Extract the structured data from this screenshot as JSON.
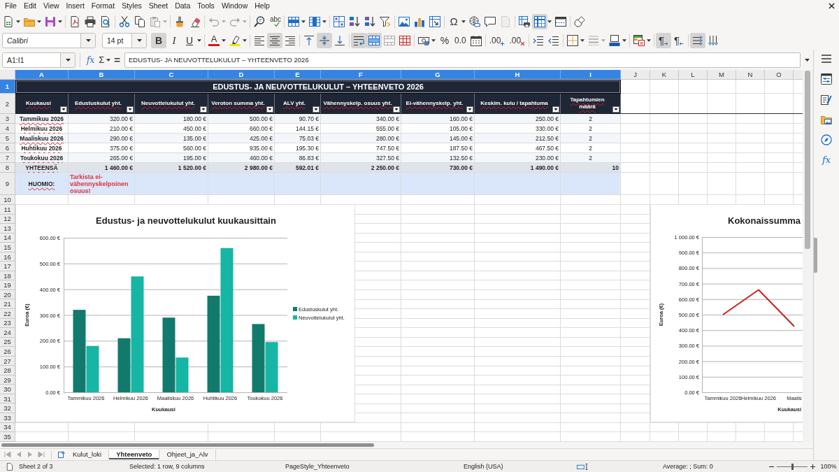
{
  "menu_bar": {
    "items": [
      "File",
      "Edit",
      "View",
      "Insert",
      "Format",
      "Styles",
      "Sheet",
      "Data",
      "Tools",
      "Window",
      "Help"
    ]
  },
  "standard_toolbar": {
    "groups": [
      [
        {
          "kind": "new",
          "on": false,
          "disabled": false,
          "menu": true
        },
        {
          "kind": "open",
          "on": false,
          "disabled": false,
          "menu": true
        },
        {
          "kind": "save",
          "on": false,
          "disabled": false,
          "menu": true
        }
      ],
      [
        {
          "kind": "pdf",
          "on": false,
          "disabled": false,
          "menu": false
        },
        {
          "kind": "print",
          "on": false,
          "disabled": false,
          "menu": false
        },
        {
          "kind": "preview",
          "on": false,
          "disabled": false,
          "menu": false
        }
      ],
      [
        {
          "kind": "cut",
          "on": false,
          "disabled": false,
          "menu": false
        },
        {
          "kind": "copy",
          "on": false,
          "disabled": false,
          "menu": false
        },
        {
          "kind": "paste",
          "on": false,
          "disabled": true,
          "menu": true
        }
      ],
      [
        {
          "kind": "clone",
          "on": false,
          "disabled": false,
          "menu": false
        },
        {
          "kind": "clear",
          "on": false,
          "disabled": false,
          "menu": false
        }
      ],
      [
        {
          "kind": "undo",
          "on": false,
          "disabled": true,
          "menu": true
        },
        {
          "kind": "redo",
          "on": false,
          "disabled": true,
          "menu": true
        }
      ],
      [
        {
          "kind": "find",
          "on": false,
          "disabled": false,
          "menu": false
        },
        {
          "kind": "spelling",
          "glyph": "abc",
          "on": false,
          "disabled": false,
          "menu": false
        }
      ],
      [
        {
          "kind": "rows",
          "on": false,
          "disabled": false,
          "menu": true
        },
        {
          "kind": "columns",
          "on": false,
          "disabled": false,
          "menu": true
        }
      ],
      [
        {
          "kind": "sort",
          "on": false,
          "disabled": false,
          "menu": false
        },
        {
          "kind": "ascending",
          "on": false,
          "disabled": false,
          "menu": false
        },
        {
          "kind": "descending",
          "on": false,
          "disabled": false,
          "menu": false
        },
        {
          "kind": "filter",
          "on": false,
          "disabled": false,
          "menu": false
        }
      ],
      [
        {
          "kind": "image",
          "on": false,
          "disabled": false,
          "menu": false
        },
        {
          "kind": "chart",
          "on": false,
          "disabled": false,
          "menu": false
        },
        {
          "kind": "pivot",
          "on": false,
          "disabled": false,
          "menu": false
        }
      ],
      [
        {
          "kind": "special",
          "glyph": "Ω",
          "on": false,
          "disabled": false,
          "menu": true
        },
        {
          "kind": "hyperlink",
          "on": false,
          "disabled": false,
          "menu": false
        },
        {
          "kind": "comment",
          "on": false,
          "disabled": false,
          "menu": false
        },
        {
          "kind": "headerfooter",
          "on": false,
          "disabled": true,
          "menu": false
        }
      ],
      [
        {
          "kind": "printarea",
          "on": false,
          "disabled": false,
          "menu": false
        },
        {
          "kind": "freeze",
          "on": true,
          "disabled": false,
          "menu": true
        },
        {
          "kind": "split",
          "on": false,
          "disabled": false,
          "menu": false
        }
      ],
      [
        {
          "kind": "shapes",
          "on": false,
          "disabled": false,
          "menu": false
        }
      ]
    ]
  },
  "formatting_toolbar": {
    "font_name": "Calibri",
    "font_size": "14 pt",
    "groups": [
      [
        {
          "kind": "bold",
          "glyph": "B",
          "on": true,
          "disabled": false,
          "menu": false
        },
        {
          "kind": "italic",
          "glyph": "I",
          "on": false,
          "disabled": false,
          "menu": false
        },
        {
          "kind": "underline",
          "glyph": "U",
          "on": false,
          "disabled": false,
          "menu": true
        }
      ],
      [
        {
          "kind": "fontcolor",
          "glyph": "A",
          "on": false,
          "disabled": false,
          "menu": true
        },
        {
          "kind": "highlight",
          "on": false,
          "disabled": false,
          "menu": true
        }
      ],
      [
        {
          "kind": "left",
          "on": false,
          "disabled": false,
          "menu": false
        },
        {
          "kind": "center",
          "on": true,
          "disabled": false,
          "menu": false
        },
        {
          "kind": "right",
          "on": false,
          "disabled": false,
          "menu": false
        }
      ],
      [
        {
          "kind": "top",
          "on": false,
          "disabled": false,
          "menu": false
        },
        {
          "kind": "middle",
          "on": true,
          "disabled": false,
          "menu": false
        },
        {
          "kind": "bottom",
          "on": false,
          "disabled": false,
          "menu": false
        }
      ],
      [
        {
          "kind": "wrap",
          "on": true,
          "disabled": false,
          "menu": false
        },
        {
          "kind": "mergecenter",
          "on": true,
          "disabled": false,
          "menu": false
        },
        {
          "kind": "merge",
          "on": false,
          "disabled": true,
          "menu": false
        },
        {
          "kind": "unmerge",
          "on": false,
          "disabled": false,
          "menu": false
        }
      ],
      [
        {
          "kind": "currency",
          "on": false,
          "disabled": false,
          "menu": true
        },
        {
          "kind": "percent",
          "glyph": "%",
          "on": false,
          "disabled": false,
          "menu": false
        },
        {
          "kind": "number",
          "glyph": "0.0",
          "on": false,
          "disabled": false,
          "menu": false
        },
        {
          "kind": "date",
          "on": false,
          "disabled": false,
          "menu": false
        }
      ],
      [
        {
          "kind": "adddecimal",
          "glyph": ".00",
          "on": false,
          "disabled": false,
          "menu": false
        },
        {
          "kind": "deletedecimal",
          "glyph": ".00",
          "on": false,
          "disabled": false,
          "menu": false
        }
      ],
      [
        {
          "kind": "indent",
          "on": false,
          "disabled": false,
          "menu": false
        },
        {
          "kind": "outdent",
          "on": false,
          "disabled": false,
          "menu": false
        }
      ],
      [
        {
          "kind": "borders",
          "on": false,
          "disabled": false,
          "menu": true
        },
        {
          "kind": "borderstyle",
          "on": false,
          "disabled": true,
          "menu": true
        },
        {
          "kind": "bordercolor",
          "on": false,
          "disabled": false,
          "menu": true
        }
      ],
      [
        {
          "kind": "conditional",
          "on": false,
          "disabled": false,
          "menu": true
        }
      ],
      [
        {
          "kind": "ltr",
          "glyph": "¶",
          "on": true,
          "disabled": false,
          "menu": false
        },
        {
          "kind": "rtl",
          "glyph": "¶",
          "on": false,
          "disabled": false,
          "menu": false
        }
      ],
      [
        {
          "kind": "horizontal",
          "on": true,
          "disabled": false,
          "menu": false
        },
        {
          "kind": "vertical",
          "on": false,
          "disabled": false,
          "menu": false
        }
      ]
    ]
  },
  "formula_bar": {
    "name_box": "A1:I1",
    "buttons": [
      {
        "glyph": "fx",
        "menu": false
      },
      {
        "glyph": "Σ",
        "menu": true
      },
      {
        "glyph": "=",
        "menu": false
      }
    ],
    "content": "EDUSTUS- JA NEUVOTTELUKULUT – YHTEENVETO 2026"
  },
  "sheet": {
    "column_headers": [
      {
        "label": "A",
        "selected": true
      },
      {
        "label": "B",
        "selected": true
      },
      {
        "label": "C",
        "selected": true
      },
      {
        "label": "D",
        "selected": true
      },
      {
        "label": "E",
        "selected": true
      },
      {
        "label": "F",
        "selected": true
      },
      {
        "label": "G",
        "selected": true
      },
      {
        "label": "H",
        "selected": true
      },
      {
        "label": "I",
        "selected": true
      },
      {
        "label": "J",
        "selected": false
      },
      {
        "label": "K",
        "selected": false
      },
      {
        "label": "L",
        "selected": false
      },
      {
        "label": "M",
        "selected": false
      },
      {
        "label": "N",
        "selected": false
      },
      {
        "label": "O",
        "selected": false
      }
    ],
    "row_headers": [
      {
        "label": "1",
        "selected": true
      },
      {
        "label": "2",
        "selected": false
      },
      {
        "label": "3",
        "selected": false
      },
      {
        "label": "4",
        "selected": false
      },
      {
        "label": "5",
        "selected": false
      },
      {
        "label": "6",
        "selected": false
      },
      {
        "label": "7",
        "selected": false
      },
      {
        "label": "8",
        "selected": false
      },
      {
        "label": "9",
        "selected": false
      },
      {
        "label": "10",
        "selected": false
      },
      {
        "label": "11",
        "selected": false
      },
      {
        "label": "12",
        "selected": false
      },
      {
        "label": "13",
        "selected": false
      },
      {
        "label": "14",
        "selected": false
      },
      {
        "label": "15",
        "selected": false
      },
      {
        "label": "16",
        "selected": false
      },
      {
        "label": "17",
        "selected": false
      },
      {
        "label": "18",
        "selected": false
      },
      {
        "label": "19",
        "selected": false
      },
      {
        "label": "20",
        "selected": false
      },
      {
        "label": "21",
        "selected": false
      },
      {
        "label": "22",
        "selected": false
      },
      {
        "label": "23",
        "selected": false
      },
      {
        "label": "24",
        "selected": false
      },
      {
        "label": "25",
        "selected": false
      },
      {
        "label": "26",
        "selected": false
      },
      {
        "label": "27",
        "selected": false
      },
      {
        "label": "28",
        "selected": false
      },
      {
        "label": "29",
        "selected": false
      },
      {
        "label": "30",
        "selected": false
      },
      {
        "label": "31",
        "selected": false
      },
      {
        "label": "32",
        "selected": false
      },
      {
        "label": "33",
        "selected": false
      },
      {
        "label": "34",
        "selected": false
      },
      {
        "label": "35",
        "selected": false
      }
    ],
    "spell_marks": true,
    "title": "EDUSTUS- JA NEUVOTTELUKULUT – YHTEENVETO 2026",
    "headers": [
      {
        "label": "Kuukausi",
        "filter": true
      },
      {
        "label": "Edustuskulut yht.",
        "filter": true
      },
      {
        "label": "Neuvottelukulut yht.",
        "filter": true
      },
      {
        "label": "Veroton summa yht.",
        "filter": true
      },
      {
        "label": "ALV yht.",
        "filter": true
      },
      {
        "label": "Vähennyskelp. osuus yht.",
        "filter": true
      },
      {
        "label": "Ei-vähennyskelp. yht.",
        "filter": true
      },
      {
        "label": "Keskim. kulu / tapahtuma",
        "filter": true
      },
      {
        "label": "Tapahtumien määrä",
        "filter": true
      }
    ],
    "rows": [
      [
        "Tammikuu 2026",
        "320.00 €",
        "180.00 €",
        "500.00 €",
        "90.70 €",
        "340.00 €",
        "160.00 €",
        "250.00 €",
        "2"
      ],
      [
        "Helmikuu 2026",
        "210.00 €",
        "450.00 €",
        "660.00 €",
        "144.15 €",
        "555.00 €",
        "105.00 €",
        "330.00 €",
        "2"
      ],
      [
        "Maaliskuu 2026",
        "290.00 €",
        "135.00 €",
        "425.00 €",
        "75.03 €",
        "280.00 €",
        "145.00 €",
        "212.50 €",
        "2"
      ],
      [
        "Huhtikuu 2026",
        "375.00 €",
        "560.00 €",
        "935.00 €",
        "195.30 €",
        "747.50 €",
        "187.50 €",
        "467.50 €",
        "2"
      ],
      [
        "Toukokuu 2026",
        "265.00 €",
        "195.00 €",
        "460.00 €",
        "86.83 €",
        "327.50 €",
        "132.50 €",
        "230.00 €",
        "2"
      ]
    ],
    "total": [
      "YHTEENSÄ",
      "1 460.00 €",
      "1 520.00 €",
      "2 980.00 €",
      "592.01 €",
      "2 250.00 €",
      "730.00 €",
      "1 490.00 €",
      "10"
    ],
    "note": {
      "label": "HUOMIO:",
      "text": "Tarkista ei-vähennyskelpoinen osuus!"
    },
    "charts": [
      {
        "chart_data": {
          "type": "bar",
          "title": "Edustus- ja neuvottelukulut kuukausittain",
          "xlabel": "Kuukausi",
          "ylabel": "Euroa (€)",
          "categories": [
            "Tammikuu 2026",
            "Helmikuu 2026",
            "Maaliskuu 2026",
            "Huhtikuu 2026",
            "Toukokuu 2026"
          ],
          "series": [
            {
              "name": "Edustuskulut yht.",
              "color": "#127a6d",
              "values": [
                320,
                210,
                290,
                375,
                265
              ]
            },
            {
              "name": "Neuvottelukulut yht.",
              "color": "#17b5a3",
              "values": [
                180,
                450,
                135,
                560,
                195
              ]
            }
          ],
          "ylim": [
            0,
            600
          ],
          "yticks": [
            {
              "value": 0,
              "label": "0.00 €"
            },
            {
              "value": 100,
              "label": "100.00 €"
            },
            {
              "value": 200,
              "label": "200.00 €"
            },
            {
              "value": 300,
              "label": "300.00 €"
            },
            {
              "value": 400,
              "label": "400.00 €"
            },
            {
              "value": 500,
              "label": "500.00 €"
            },
            {
              "value": 600,
              "label": "600.00 €"
            }
          ],
          "grid": true,
          "legend": "right"
        }
      },
      {
        "chart_data": {
          "type": "line",
          "title": "Kokonaissumma",
          "xlabel": "Kuukausi",
          "ylabel": "Euroa (€)",
          "categories": [
            "Tammikuu 2026",
            "Helmikuu 2026",
            "Maalis"
          ],
          "series": [
            {
              "color": "#c9211e",
              "values": [
                500,
                660,
                425
              ]
            }
          ],
          "ylim": [
            0,
            1000
          ],
          "yticks": [
            {
              "value": 0,
              "label": "0.00 €"
            },
            {
              "value": 100,
              "label": "100.00 €"
            },
            {
              "value": 200,
              "label": "200.00 €"
            },
            {
              "value": 300,
              "label": "300.00 €"
            },
            {
              "value": 400,
              "label": "400.00 €"
            },
            {
              "value": 500,
              "label": "500.00 €"
            },
            {
              "value": 600,
              "label": "600.00 €"
            },
            {
              "value": 700,
              "label": "700.00 €"
            },
            {
              "value": 800,
              "label": "800.00 €"
            },
            {
              "value": 900,
              "label": "900.00 €"
            },
            {
              "value": 1000,
              "label": "1 000.00 €"
            }
          ],
          "grid": true
        }
      }
    ]
  },
  "sheet_tabs": [
    {
      "label": "Kulut_loki",
      "selected": false
    },
    {
      "label": "Yhteenveto",
      "selected": true
    },
    {
      "label": "Ohjeet_ja_Alv",
      "selected": false
    }
  ],
  "status_bar": {
    "sheet": "Sheet 2 of 3",
    "selection": "Selected: 1 row, 9 columns",
    "page_style": "PageStyle_Yhteenveto",
    "language": "English (USA)",
    "summary": "Average: ; Sum: 0",
    "zoom": {
      "level": 0.5,
      "reading": "100%"
    }
  },
  "sidebar": {
    "tabs": [
      {
        "kind": "properties"
      },
      {
        "kind": "styles"
      },
      {
        "kind": "gallery"
      },
      {
        "kind": "navigator"
      },
      {
        "kind": "functions",
        "glyph": "fx"
      }
    ]
  }
}
